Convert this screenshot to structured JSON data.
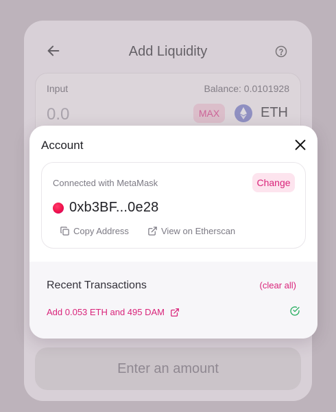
{
  "page": {
    "title": "Add Liquidity"
  },
  "input_panel": {
    "label": "Input",
    "balance": "Balance: 0.0101928",
    "amount_placeholder": "0.0",
    "max_label": "MAX",
    "token": "ETH"
  },
  "enter_button": {
    "label": "Enter an amount"
  },
  "modal": {
    "title": "Account",
    "connected_text": "Connected with MetaMask",
    "change_label": "Change",
    "address": "0xb3BF...0e28",
    "copy_label": "Copy Address",
    "etherscan_label": "View on Etherscan",
    "recent_title": "Recent Transactions",
    "clear_all_label": "(clear all)",
    "transactions": [
      {
        "label": "Add 0.053 ETH and 495 DAM",
        "status": "success"
      }
    ]
  },
  "colors": {
    "accent": "#d9247a",
    "success": "#27ae60",
    "overlay": "#bdb3bb"
  },
  "icons": {
    "back": "arrow-left-icon",
    "help": "question-circle-icon",
    "close": "close-icon",
    "copy": "copy-icon",
    "external": "external-link-icon",
    "success": "check-circle-icon",
    "token": "ethereum-icon"
  }
}
